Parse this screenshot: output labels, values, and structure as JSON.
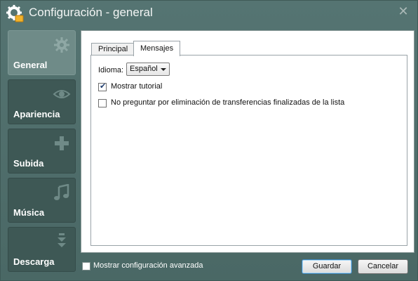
{
  "window": {
    "title": "Configuración - general",
    "close_symbol": "✕"
  },
  "sidebar": {
    "items": [
      {
        "label": "General",
        "icon": "gear-icon",
        "active": true
      },
      {
        "label": "Apariencia",
        "icon": "eye-icon",
        "active": false
      },
      {
        "label": "Subida",
        "icon": "plus-icon",
        "active": false
      },
      {
        "label": "Música",
        "icon": "music-note-icon",
        "active": false
      },
      {
        "label": "Descarga",
        "icon": "double-chevron-down-icon",
        "active": false
      }
    ]
  },
  "tabs": [
    {
      "label": "Principal",
      "active": false
    },
    {
      "label": "Mensajes",
      "active": true
    }
  ],
  "messages": {
    "language_label": "Idioma:",
    "language_value": "Español",
    "show_tutorial": {
      "label": "Mostrar tutorial",
      "checked": true
    },
    "no_ask_delete": {
      "label": "No preguntar por eliminación de transferencias finalizadas de la lista",
      "checked": false
    }
  },
  "footer": {
    "advanced": {
      "label": "Mostrar configuración avanzada",
      "checked": false
    },
    "save_label": "Guardar",
    "cancel_label": "Cancelar"
  },
  "colors": {
    "window_bg": "#4f6d6a",
    "sidebar_active": "#6f8b88",
    "sidebar_item": "#3e5855",
    "icon_tint": "#8fa8a5",
    "primary_button_border": "#3c7fb1"
  }
}
